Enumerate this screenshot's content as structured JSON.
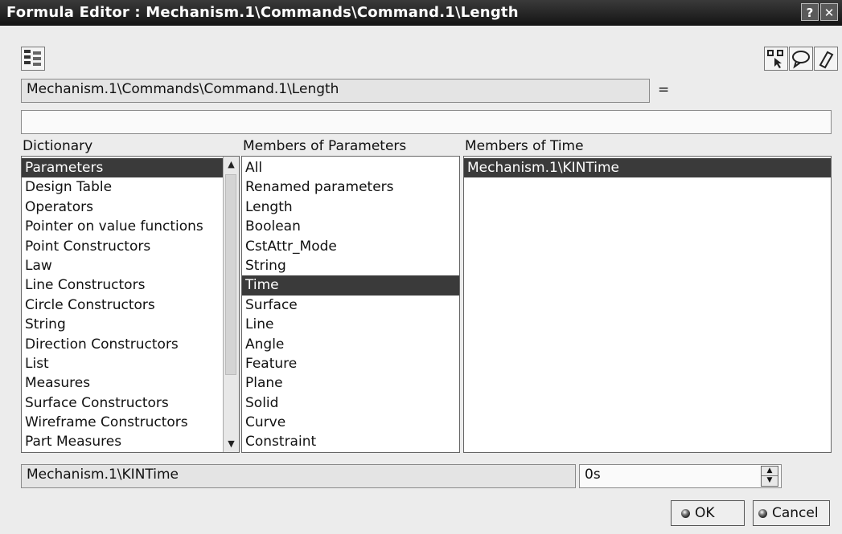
{
  "window": {
    "title": "Formula Editor : Mechanism.1\\Commands\\Command.1\\Length",
    "help_glyph": "?",
    "close_glyph": "✕"
  },
  "toolbar": {
    "left_icon": "parameter-tree-icon",
    "right_icons": [
      "selection-tool-icon",
      "comment-icon",
      "erase-icon"
    ]
  },
  "formula": {
    "parameter_path": "Mechanism.1\\Commands\\Command.1\\Length",
    "equals": "=",
    "expression": ""
  },
  "dictionary": {
    "label": "Dictionary",
    "items": [
      "Parameters",
      "Design Table",
      "Operators",
      "Pointer on value functions",
      "Point Constructors",
      "Law",
      "Line Constructors",
      "Circle Constructors",
      "String",
      "Direction Constructors",
      "List",
      "Measures",
      "Surface Constructors",
      "Wireframe Constructors",
      "Part Measures"
    ],
    "selected": "Parameters"
  },
  "members_params": {
    "label": "Members of Parameters",
    "items": [
      "All",
      "Renamed parameters",
      "Length",
      "Boolean",
      "CstAttr_Mode",
      "String",
      "Time",
      "Surface",
      "Line",
      "Angle",
      "Feature",
      "Plane",
      "Solid",
      "Curve",
      "Constraint"
    ],
    "selected": "Time"
  },
  "members_time": {
    "label": "Members of Time",
    "items": [
      "Mechanism.1\\KINTime"
    ],
    "selected": "Mechanism.1\\KINTime"
  },
  "bottom": {
    "selected_member": "Mechanism.1\\KINTime",
    "value": "0s"
  },
  "buttons": {
    "ok": "OK",
    "cancel": "Cancel"
  }
}
